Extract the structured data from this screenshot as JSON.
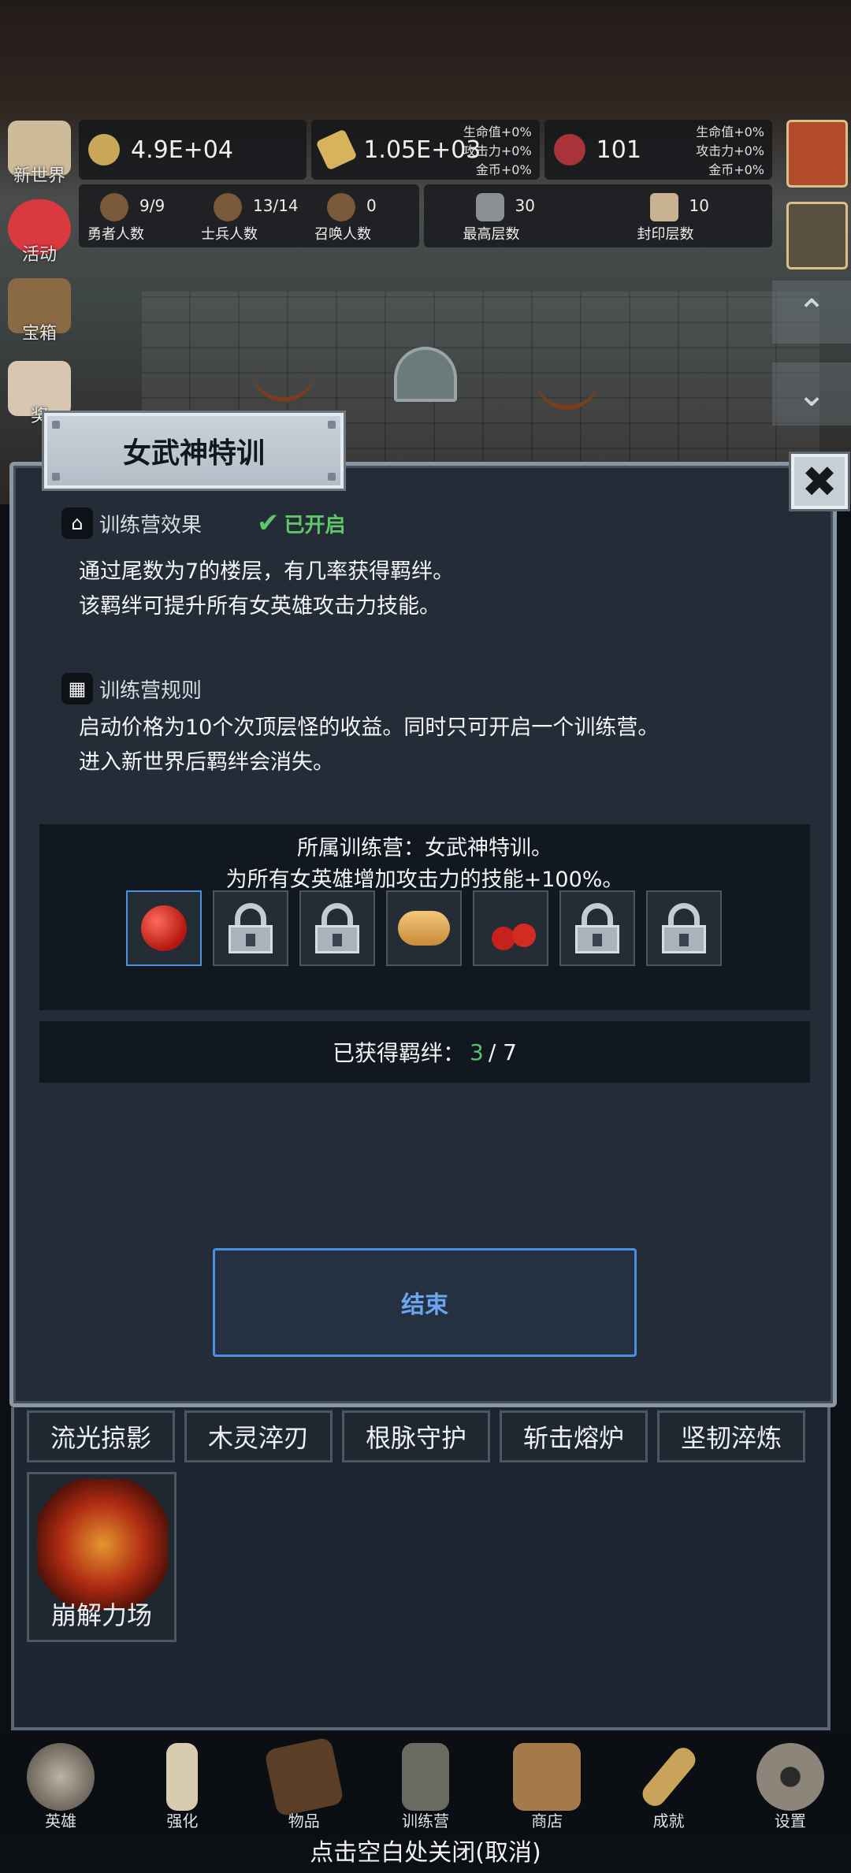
{
  "left_menu": [
    {
      "label": "新世界",
      "icon": "scroll-map-icon"
    },
    {
      "label": "活动",
      "icon": "heart-icon"
    },
    {
      "label": "宝箱",
      "icon": "treasure-chest-icon"
    },
    {
      "label": "奖",
      "icon": "envelope-icon"
    }
  ],
  "resources": [
    {
      "value": "4.9E+04",
      "icon": "gold-coin-icon",
      "stats": []
    },
    {
      "value": "1.05E+03",
      "icon": "gold-bar-icon",
      "stats": [
        "生命值+0%",
        "攻击力+0%",
        "金币+0%"
      ]
    },
    {
      "value": "101",
      "icon": "meat-icon",
      "stats": [
        "生命值+0%",
        "攻击力+0%",
        "金币+0%"
      ]
    }
  ],
  "counts": [
    {
      "value": "9/9",
      "label": "勇者人数"
    },
    {
      "value": "13/14",
      "label": "士兵人数"
    },
    {
      "value": "0",
      "label": "召唤人数"
    },
    {
      "value": "30",
      "label": "最高层数"
    },
    {
      "value": "10",
      "label": "封印层数"
    }
  ],
  "arrows": {
    "up": "⌃",
    "down": "⌄"
  },
  "dialog": {
    "title": "女武神特训",
    "close": "✖",
    "effect_title": "训练营效果",
    "status": "已开启",
    "effect_lines": [
      "通过尾数为7的楼层，有几率获得羁绊。",
      "该羁绊可提升所有女英雄攻击力技能。"
    ],
    "rules_title": "训练营规则",
    "rules_lines": [
      "启动价格为10个次顶层怪的收益。同时只可开启一个训练营。",
      "进入新世界后羁绊会消失。"
    ],
    "camp_line1": "所属训练营：女武神特训。",
    "camp_line2": "为所有女英雄增加攻击力的技能+100%。",
    "slots": [
      "apple-icon",
      "lock-icon",
      "lock-icon",
      "pancake-icon",
      "cherry-icon",
      "lock-icon",
      "lock-icon"
    ],
    "bond_label": "已获得羁绊：",
    "bond_current": "3",
    "bond_total": "/ 7",
    "end_button": "结束"
  },
  "skills": [
    "流光掠影",
    "木灵淬刃",
    "根脉守护",
    "斩击熔炉",
    "坚韧淬炼"
  ],
  "skill_card": "崩解力场",
  "bottom_nav": [
    {
      "label": "英雄",
      "icon": "skull-icon"
    },
    {
      "label": "强化",
      "icon": "candle-icon"
    },
    {
      "label": "物品",
      "icon": "book-icon"
    },
    {
      "label": "训练营",
      "icon": "lantern-icon"
    },
    {
      "label": "商店",
      "icon": "mug-icon"
    },
    {
      "label": "成就",
      "icon": "key-icon"
    },
    {
      "label": "设置",
      "icon": "gear-icon"
    }
  ],
  "close_hint": "点击空白处关闭(取消)",
  "colors": {
    "accent_blue": "#4e8fe0",
    "status_green": "#62c56c",
    "panel": "#232c37"
  }
}
